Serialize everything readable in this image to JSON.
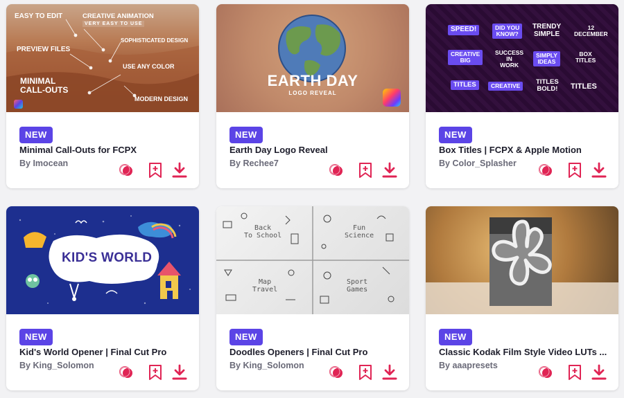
{
  "cards": [
    {
      "badge": "NEW",
      "title": "Minimal Call-Outs for FCPX",
      "author": "By Imocean",
      "thumb_texts": {
        "easy": "EASY TO EDIT",
        "creative": "CREATIVE ANIMATION",
        "very_easy": "VERY EASY TO USE",
        "sophisticated": "SOPHISTICATED DESIGN",
        "preview": "PREVIEW FILES",
        "color": "USE ANY COLOR",
        "minimal": "MINIMAL\nCALL-OUTS",
        "modern": "MODERN DESIGN"
      }
    },
    {
      "badge": "NEW",
      "title": "Earth Day Logo Reveal",
      "author": "By Rechee7",
      "thumb_texts": {
        "main": "EARTH DAY",
        "sub": "LOGO REVEAL"
      }
    },
    {
      "badge": "NEW",
      "title": "Box Titles | FCPX & Apple Motion",
      "author": "By Color_Splasher",
      "thumb_texts": {
        "t1": "SPEED!",
        "t2": "DID YOU\nKNOW?",
        "t3": "TRENDY\nSIMPLE",
        "t4": "12\nDECEMBER",
        "t5": "CREATIVE\nBIG",
        "t6": "SUCCESS\nIN\nWORK",
        "t7": "SIMPLY\nIDEAS",
        "t8": "BOX\nTITLES",
        "t9": "TITLES",
        "t10": "CREATIVE",
        "t11": "TITLES\nBOLD!",
        "t12": "TITLES"
      }
    },
    {
      "badge": "NEW",
      "title": "Kid's World Opener | Final Cut Pro",
      "author": "By King_Solomon",
      "thumb_texts": {
        "main": "KID'S WORLD"
      }
    },
    {
      "badge": "NEW",
      "title": "Doodles Openers | Final Cut Pro",
      "author": "By King_Solomon",
      "thumb_texts": {
        "q1": "Back\nTo School",
        "q2": "Fun\nScience",
        "q3": "Map\nTravel",
        "q4": "Sport\nGames"
      }
    },
    {
      "badge": "NEW",
      "title": "Classic Kodak Film Style Video LUTs ...",
      "author": "By aaapresets",
      "thumb_texts": {}
    }
  ],
  "icons": {
    "preview": "preview-circles-icon",
    "save": "bookmark-add-icon",
    "download": "download-icon"
  },
  "colors": {
    "badge": "#5b44e6",
    "action": "#e02454",
    "title": "#1d1d2b",
    "author": "#6a6a78"
  }
}
